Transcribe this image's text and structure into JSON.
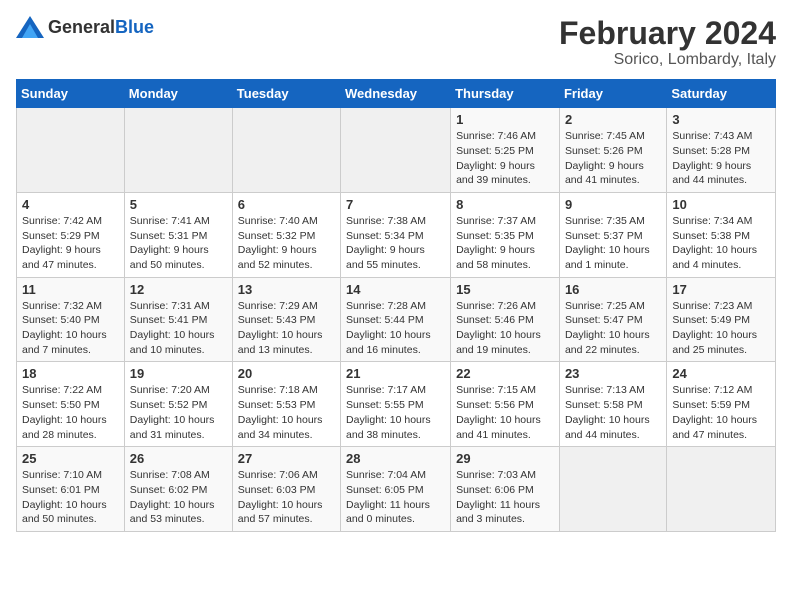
{
  "header": {
    "logo_general": "General",
    "logo_blue": "Blue",
    "title": "February 2024",
    "subtitle": "Sorico, Lombardy, Italy"
  },
  "weekdays": [
    "Sunday",
    "Monday",
    "Tuesday",
    "Wednesday",
    "Thursday",
    "Friday",
    "Saturday"
  ],
  "weeks": [
    [
      {
        "day": "",
        "info": ""
      },
      {
        "day": "",
        "info": ""
      },
      {
        "day": "",
        "info": ""
      },
      {
        "day": "",
        "info": ""
      },
      {
        "day": "1",
        "info": "Sunrise: 7:46 AM\nSunset: 5:25 PM\nDaylight: 9 hours and 39 minutes."
      },
      {
        "day": "2",
        "info": "Sunrise: 7:45 AM\nSunset: 5:26 PM\nDaylight: 9 hours and 41 minutes."
      },
      {
        "day": "3",
        "info": "Sunrise: 7:43 AM\nSunset: 5:28 PM\nDaylight: 9 hours and 44 minutes."
      }
    ],
    [
      {
        "day": "4",
        "info": "Sunrise: 7:42 AM\nSunset: 5:29 PM\nDaylight: 9 hours and 47 minutes."
      },
      {
        "day": "5",
        "info": "Sunrise: 7:41 AM\nSunset: 5:31 PM\nDaylight: 9 hours and 50 minutes."
      },
      {
        "day": "6",
        "info": "Sunrise: 7:40 AM\nSunset: 5:32 PM\nDaylight: 9 hours and 52 minutes."
      },
      {
        "day": "7",
        "info": "Sunrise: 7:38 AM\nSunset: 5:34 PM\nDaylight: 9 hours and 55 minutes."
      },
      {
        "day": "8",
        "info": "Sunrise: 7:37 AM\nSunset: 5:35 PM\nDaylight: 9 hours and 58 minutes."
      },
      {
        "day": "9",
        "info": "Sunrise: 7:35 AM\nSunset: 5:37 PM\nDaylight: 10 hours and 1 minute."
      },
      {
        "day": "10",
        "info": "Sunrise: 7:34 AM\nSunset: 5:38 PM\nDaylight: 10 hours and 4 minutes."
      }
    ],
    [
      {
        "day": "11",
        "info": "Sunrise: 7:32 AM\nSunset: 5:40 PM\nDaylight: 10 hours and 7 minutes."
      },
      {
        "day": "12",
        "info": "Sunrise: 7:31 AM\nSunset: 5:41 PM\nDaylight: 10 hours and 10 minutes."
      },
      {
        "day": "13",
        "info": "Sunrise: 7:29 AM\nSunset: 5:43 PM\nDaylight: 10 hours and 13 minutes."
      },
      {
        "day": "14",
        "info": "Sunrise: 7:28 AM\nSunset: 5:44 PM\nDaylight: 10 hours and 16 minutes."
      },
      {
        "day": "15",
        "info": "Sunrise: 7:26 AM\nSunset: 5:46 PM\nDaylight: 10 hours and 19 minutes."
      },
      {
        "day": "16",
        "info": "Sunrise: 7:25 AM\nSunset: 5:47 PM\nDaylight: 10 hours and 22 minutes."
      },
      {
        "day": "17",
        "info": "Sunrise: 7:23 AM\nSunset: 5:49 PM\nDaylight: 10 hours and 25 minutes."
      }
    ],
    [
      {
        "day": "18",
        "info": "Sunrise: 7:22 AM\nSunset: 5:50 PM\nDaylight: 10 hours and 28 minutes."
      },
      {
        "day": "19",
        "info": "Sunrise: 7:20 AM\nSunset: 5:52 PM\nDaylight: 10 hours and 31 minutes."
      },
      {
        "day": "20",
        "info": "Sunrise: 7:18 AM\nSunset: 5:53 PM\nDaylight: 10 hours and 34 minutes."
      },
      {
        "day": "21",
        "info": "Sunrise: 7:17 AM\nSunset: 5:55 PM\nDaylight: 10 hours and 38 minutes."
      },
      {
        "day": "22",
        "info": "Sunrise: 7:15 AM\nSunset: 5:56 PM\nDaylight: 10 hours and 41 minutes."
      },
      {
        "day": "23",
        "info": "Sunrise: 7:13 AM\nSunset: 5:58 PM\nDaylight: 10 hours and 44 minutes."
      },
      {
        "day": "24",
        "info": "Sunrise: 7:12 AM\nSunset: 5:59 PM\nDaylight: 10 hours and 47 minutes."
      }
    ],
    [
      {
        "day": "25",
        "info": "Sunrise: 7:10 AM\nSunset: 6:01 PM\nDaylight: 10 hours and 50 minutes."
      },
      {
        "day": "26",
        "info": "Sunrise: 7:08 AM\nSunset: 6:02 PM\nDaylight: 10 hours and 53 minutes."
      },
      {
        "day": "27",
        "info": "Sunrise: 7:06 AM\nSunset: 6:03 PM\nDaylight: 10 hours and 57 minutes."
      },
      {
        "day": "28",
        "info": "Sunrise: 7:04 AM\nSunset: 6:05 PM\nDaylight: 11 hours and 0 minutes."
      },
      {
        "day": "29",
        "info": "Sunrise: 7:03 AM\nSunset: 6:06 PM\nDaylight: 11 hours and 3 minutes."
      },
      {
        "day": "",
        "info": ""
      },
      {
        "day": "",
        "info": ""
      }
    ]
  ]
}
